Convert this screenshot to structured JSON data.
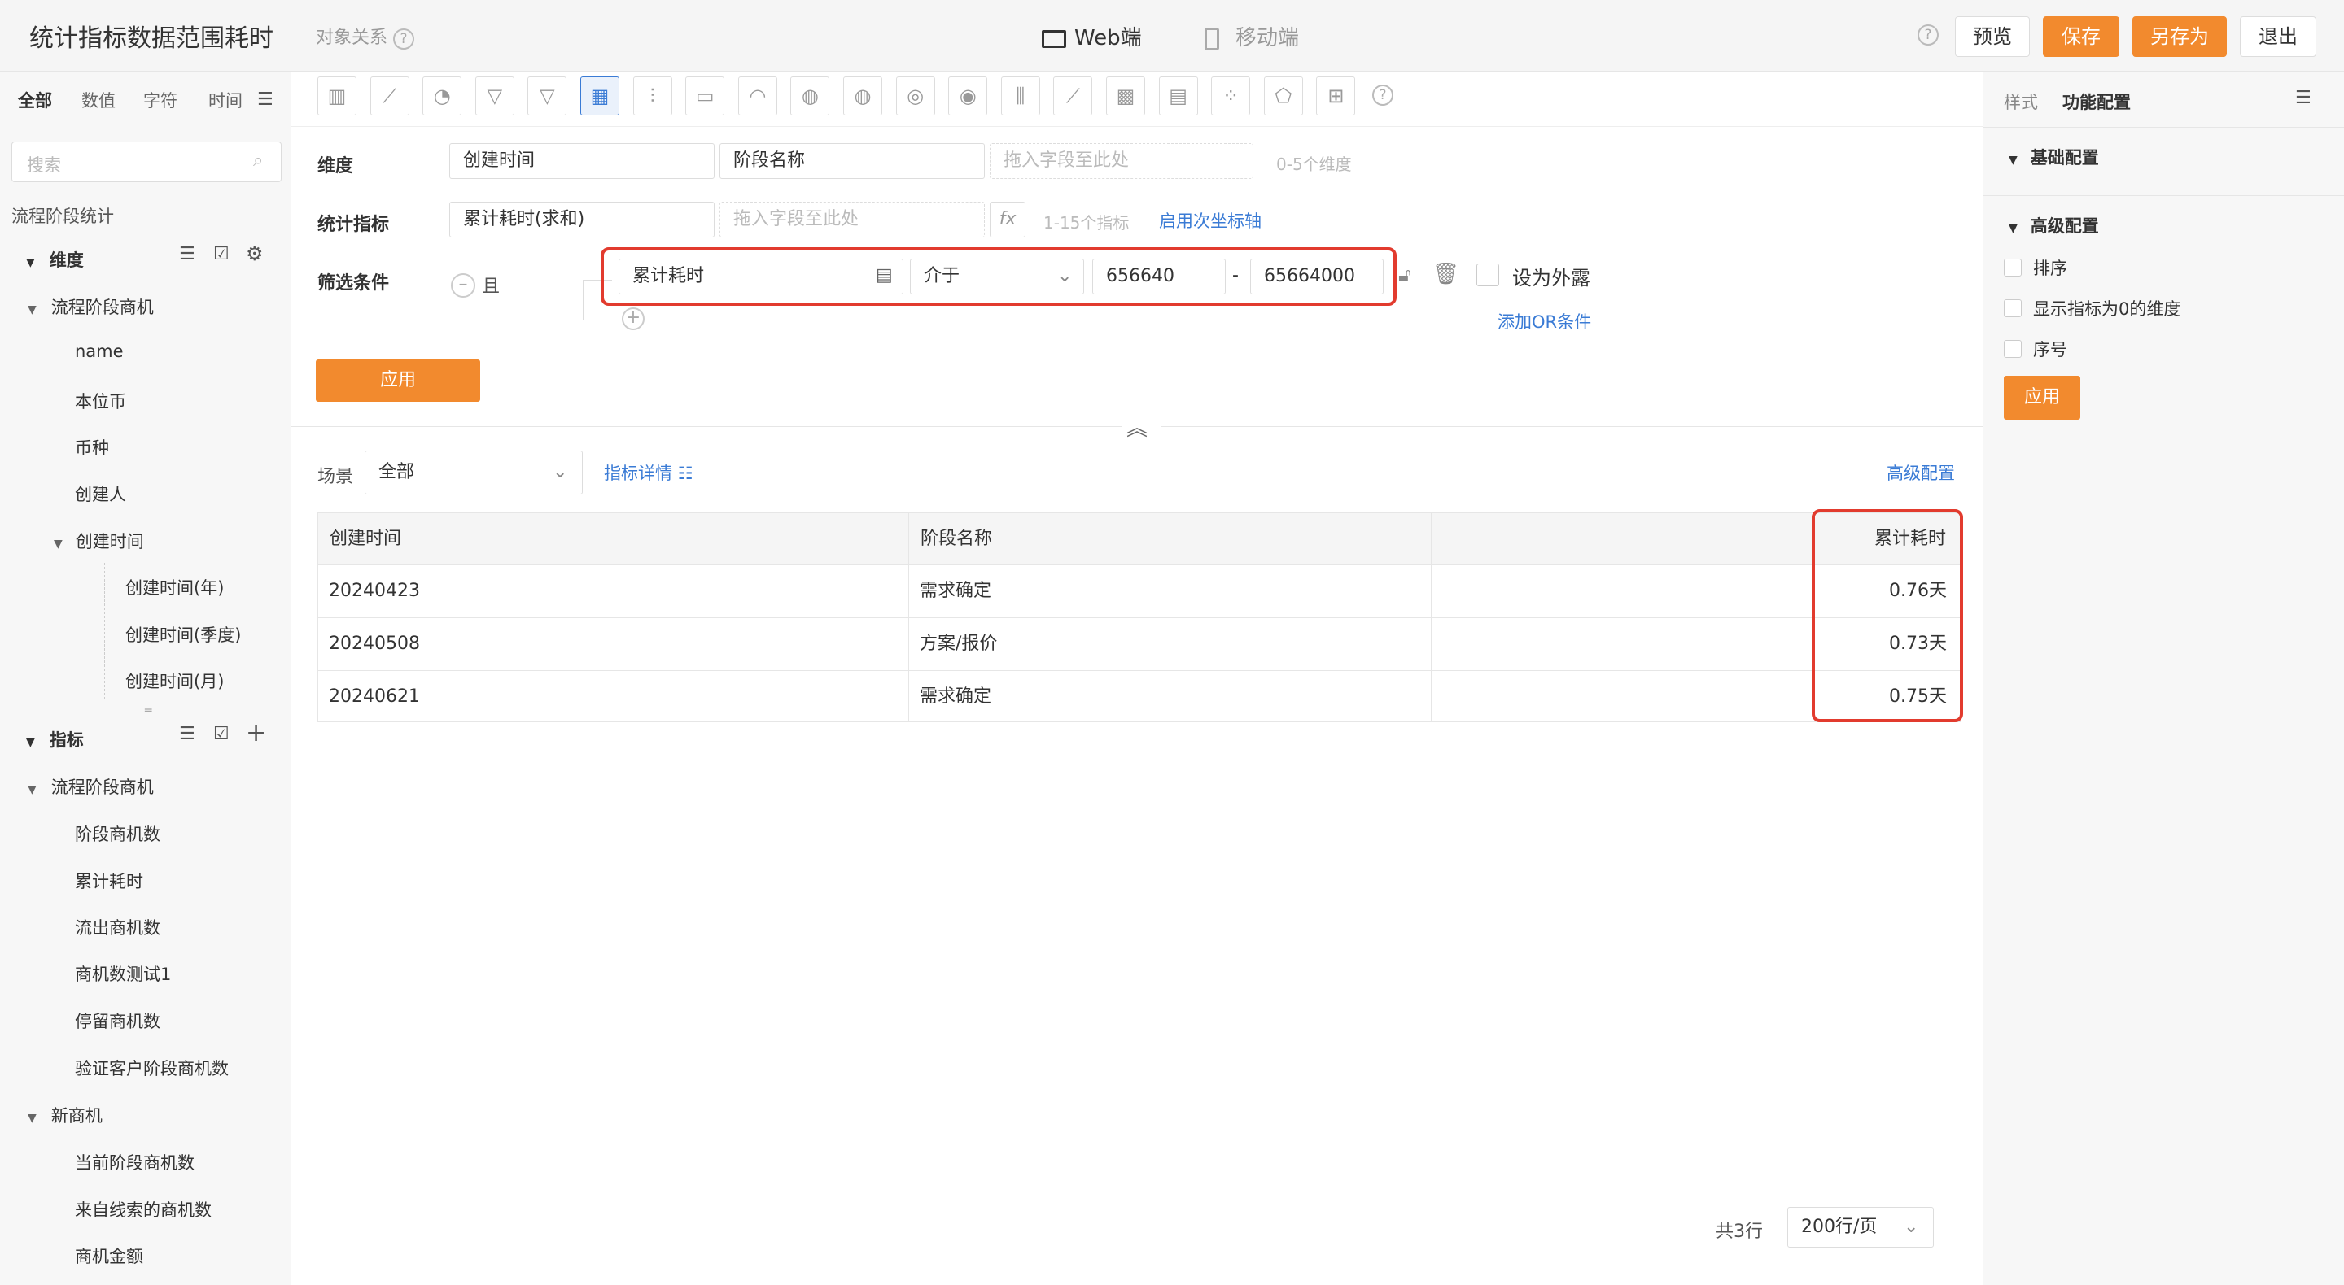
{
  "header": {
    "title": "统计指标数据范围耗时",
    "subtitle": "对象关系",
    "tab_web": "Web端",
    "tab_mobile": "移动端",
    "preview": "预览",
    "save": "保存",
    "save_as": "另存为",
    "exit": "退出"
  },
  "left": {
    "tabs": [
      "全部",
      "数值",
      "字符",
      "时间"
    ],
    "search_placeholder": "搜索",
    "group_title": "流程阶段统计",
    "dim_title": "维度",
    "dim_folder": "流程阶段商机",
    "dim_items": [
      "name",
      "本位币",
      "币种",
      "创建人"
    ],
    "created": "创建时间",
    "created_children": [
      "创建时间(年)",
      "创建时间(季度)",
      "创建时间(月)"
    ],
    "metric_title": "指标",
    "metric_folder": "流程阶段商机",
    "metric_items": [
      "阶段商机数",
      "累计耗时",
      "流出商机数",
      "商机数测试1",
      "停留商机数",
      "验证客户阶段商机数"
    ],
    "new_folder": "新商机",
    "new_items": [
      "当前阶段商机数",
      "来自线索的商机数",
      "商机金额"
    ]
  },
  "config": {
    "dim_label": "维度",
    "dim_fields": [
      "创建时间",
      "阶段名称"
    ],
    "dim_placeholder": "拖入字段至此处",
    "dim_hint": "0-5个维度",
    "metric_label": "统计指标",
    "metric_field": "累计耗时(求和)",
    "metric_placeholder": "拖入字段至此处",
    "metric_hint": "1-15个指标",
    "secondary_axis": "启用次坐标轴",
    "filter_label": "筛选条件",
    "and": "且",
    "filter_field": "累计耗时",
    "filter_op": "介于",
    "filter_min": "656640",
    "filter_max": "65664000",
    "dash": "-",
    "expose": "设为外露",
    "add_or": "添加OR条件",
    "apply": "应用"
  },
  "table": {
    "scene_label": "场景",
    "scene_value": "全部",
    "detail": "指标详情",
    "advanced": "高级配置",
    "headers": [
      "创建时间",
      "阶段名称",
      "",
      "累计耗时"
    ],
    "rows": [
      [
        "20240423",
        "需求确定",
        "",
        "0.76天"
      ],
      [
        "20240508",
        "方案/报价",
        "",
        "0.73天"
      ],
      [
        "20240621",
        "需求确定",
        "",
        "0.75天"
      ]
    ],
    "total": "共3行",
    "page_size": "200行/页"
  },
  "right": {
    "tab_style": "样式",
    "tab_func": "功能配置",
    "basic": "基础配置",
    "advanced": "高级配置",
    "opts": [
      "排序",
      "显示指标为0的维度",
      "序号"
    ],
    "apply": "应用"
  }
}
